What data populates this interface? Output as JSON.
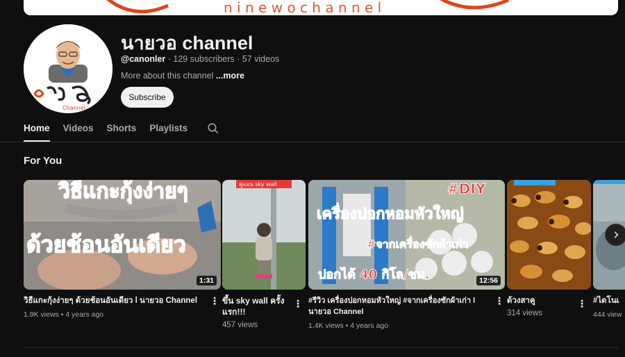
{
  "channel": {
    "name": "นายวอ channel",
    "handle": "@canonler",
    "subscribers": "129 subscribers",
    "videos": "57 videos",
    "separator": " · ",
    "about": "More about this channel",
    "more": "...more",
    "subscribe": "Subscribe",
    "avatar_logo_text": "Channel"
  },
  "tabs": [
    {
      "label": "Home",
      "active": true
    },
    {
      "label": "Videos",
      "active": false
    },
    {
      "label": "Shorts",
      "active": false
    },
    {
      "label": "Playlists",
      "active": false
    }
  ],
  "section_title": "For You",
  "videos": [
    {
      "title": "วิธีแกะกุ้งง่ายๆ ด้วยช้อนอันเดียว l นายวอ Channel",
      "meta": "1.9K views • 4 years ago",
      "duration": "1:31",
      "thumb_text_1": "วิธีแกะกุ้งง่ายๆ",
      "thumb_text_2": "ด้วยช้อนอันเดียว"
    },
    {
      "title": "ขึ้น sky wall ครั้งแรก!!!",
      "meta": "457 views",
      "thumb_tag": "คู่แอน sky wall"
    },
    {
      "title": "#รีวิว เครื่องปอกหอมหัวใหญ่ #จากเครื่องซักผ้าเก่า l นายวอ Channel",
      "meta": "1.4K views • 4 years ago",
      "duration": "12:56",
      "thumb_text_1": "เครื่องปอกหอมหัวใหญ่",
      "thumb_text_2": "#จากเครื่องซักผ้าเก่า",
      "thumb_text_3": "ปอกได้ 40 กิโล/ชม.",
      "thumb_text_4": "#DIY"
    },
    {
      "title": "ด้วงสาคู",
      "meta": "314 views"
    },
    {
      "title": "#ไดโนเ",
      "meta": "444 view"
    }
  ],
  "icons": {
    "search": "search-icon",
    "more": "more-vertical-icon",
    "next": "chevron-right-icon"
  },
  "colors": {
    "background": "#0f0f0f",
    "text_primary": "#f1f1f1",
    "text_secondary": "#aaaaaa",
    "subscribe_bg": "#f1f1f1"
  }
}
